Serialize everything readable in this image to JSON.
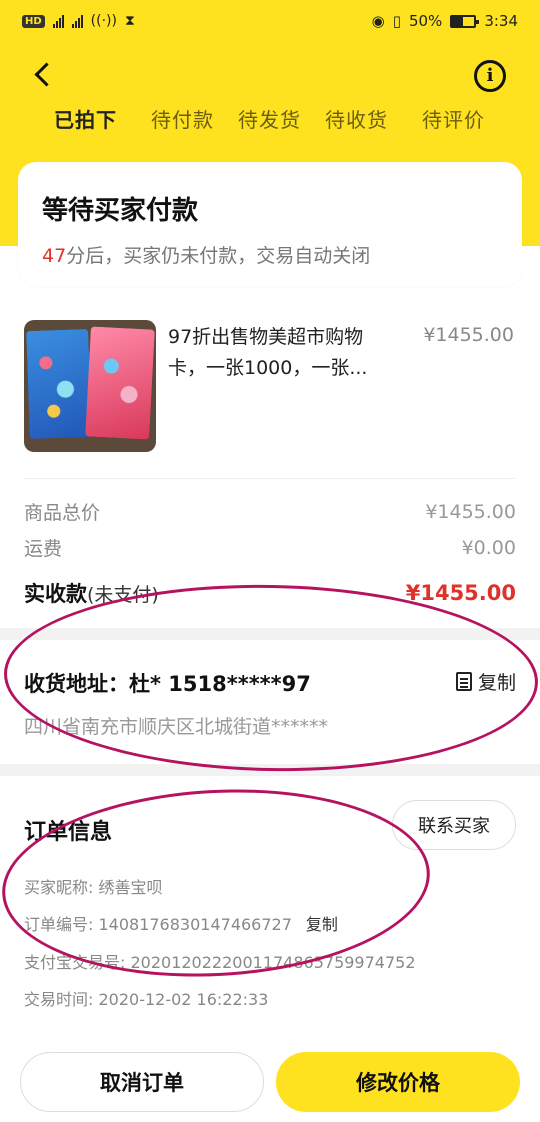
{
  "status_bar": {
    "hd_badge": "HD",
    "network_1": "2G",
    "network_2": "4G",
    "battery": "50%",
    "time": "3:34"
  },
  "nav": {
    "back_icon": "chevron-left-icon",
    "info_icon": "info-icon",
    "tabs": [
      {
        "label": "已拍下",
        "active": true
      },
      {
        "label": "待付款",
        "active": false
      },
      {
        "label": "待发货",
        "active": false
      },
      {
        "label": "待收货",
        "active": false
      },
      {
        "label": "待评价",
        "active": false
      }
    ]
  },
  "status_card": {
    "title": "等待买家付款",
    "countdown": "47",
    "message": "分后，买家仍未付款，交易自动关闭"
  },
  "product": {
    "title": "97折出售物美超市购物卡，一张1000，一张...",
    "price": "¥1455.00"
  },
  "summary": {
    "goods_total_label": "商品总价",
    "goods_total_value": "¥1455.00",
    "shipping_label": "运费",
    "shipping_value": "¥0.00",
    "received_label": "实收款",
    "received_note": "(未支付)",
    "received_value": "¥1455.00"
  },
  "address": {
    "title": "收货地址：杜*  1518*****97",
    "copy_label": "复制",
    "detail": "四川省南充市顺庆区北城街道******"
  },
  "order_info": {
    "title": "订单信息",
    "contact_label": "联系买家",
    "buyer_nickname": "买家昵称: 绣善宝呗",
    "order_number": "订单编号: 1408176830147466727",
    "order_copy": "复制",
    "alipay_number": "支付宝交易号: 2020120222001174865759974752",
    "trade_time": "交易时间: 2020-12-02 16:22:33"
  },
  "actions": {
    "cancel_label": "取消订单",
    "modify_label": "修改价格"
  },
  "colors": {
    "brand_yellow": "#ffe21f",
    "price_red": "#e0312b",
    "annotation": "#b5125f"
  }
}
